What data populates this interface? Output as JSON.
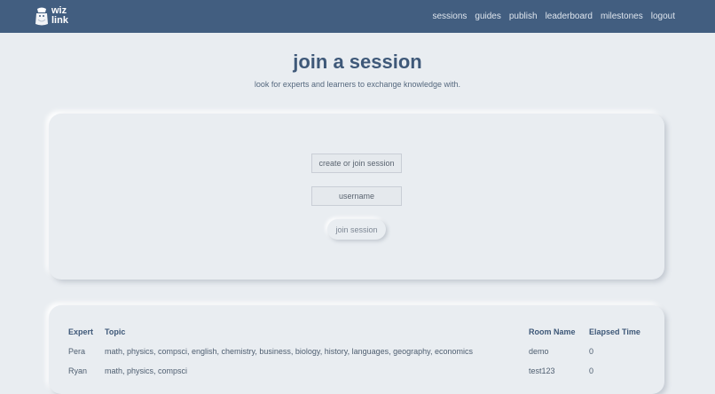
{
  "nav": {
    "logo_line1": "wiz",
    "logo_line2": "link",
    "links": [
      "sessions",
      "guides",
      "publish",
      "leaderboard",
      "milestones",
      "logout"
    ]
  },
  "page": {
    "title": "join a session",
    "subtitle": "look for experts and learners to exchange knowledge with."
  },
  "form": {
    "session_placeholder": "create or join session",
    "username_placeholder": "username",
    "join_label": "join session"
  },
  "table": {
    "headers": [
      "Expert",
      "Topic",
      "Room Name",
      "Elapsed Time"
    ],
    "rows": [
      [
        "Pera",
        "math, physics, compsci, english, chemistry, business, biology, history, languages, geography, economics",
        "demo",
        "0"
      ],
      [
        "Ryan",
        "math, physics, compsci",
        "test123",
        "0"
      ]
    ]
  },
  "colors": {
    "navbar": "#425e80",
    "background": "#e9edf1",
    "title": "#3f5979"
  }
}
